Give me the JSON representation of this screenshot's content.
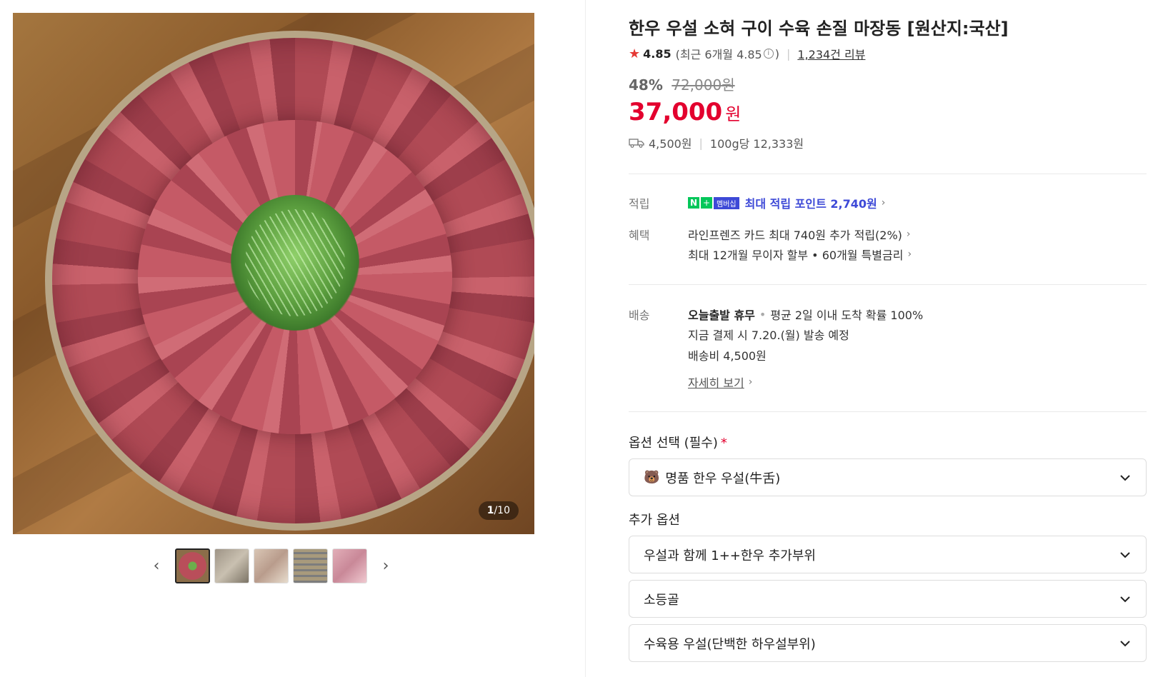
{
  "gallery": {
    "counter_current": "1",
    "counter_total": "/10",
    "thumbnails": [
      "thumb-1",
      "thumb-2",
      "thumb-3",
      "thumb-4",
      "thumb-5"
    ]
  },
  "product": {
    "title": "한우 우설 소혀 구이 수육 손질 마장동 [원산지:국산]",
    "rating": "4.85",
    "rating_recent": "(최근 6개월 4.85",
    "rating_recent_close": ")",
    "reviews": "1,234건 리뷰",
    "discount_rate": "48%",
    "original_price": "72,000원",
    "sale_price": "37,000",
    "sale_unit": "원",
    "shipping_fee": "4,500원",
    "unit_price": "100g당 12,333원"
  },
  "benefits": {
    "points_label": "적립",
    "npay_n": "N",
    "npay_plus": "+",
    "npay_member": "멤버십",
    "points_text": "최대 적립 포인트 2,740원",
    "benefit_label": "혜택",
    "benefit_1": "라인프렌즈 카드 최대 740원 추가 적립(2%)",
    "benefit_2": "최대 12개월 무이자 할부 • 60개월 특별금리"
  },
  "delivery": {
    "label": "배송",
    "status": "오늘출발 휴무",
    "arrival": "평균 2일 이내 도착 확률 100%",
    "dispatch": "지금 결제 시 7.20.(월) 발송 예정",
    "fee": "배송비 4,500원",
    "detail_link": "자세히 보기"
  },
  "options": {
    "required_title": "옵션 선택 (필수)",
    "required_mark": "*",
    "required_selected": "명품 한우 우설(牛舌)",
    "extra_title": "추가 옵션",
    "extra_1": "우설과 함께 1++한우 추가부위",
    "extra_2": "소등골",
    "extra_3": "수육용 우설(단백한 하우설부위)"
  },
  "colors": {
    "sale": "#e3002e",
    "npay_green": "#03c75a",
    "membership_blue": "#3d49d7",
    "star": "#e53935"
  }
}
